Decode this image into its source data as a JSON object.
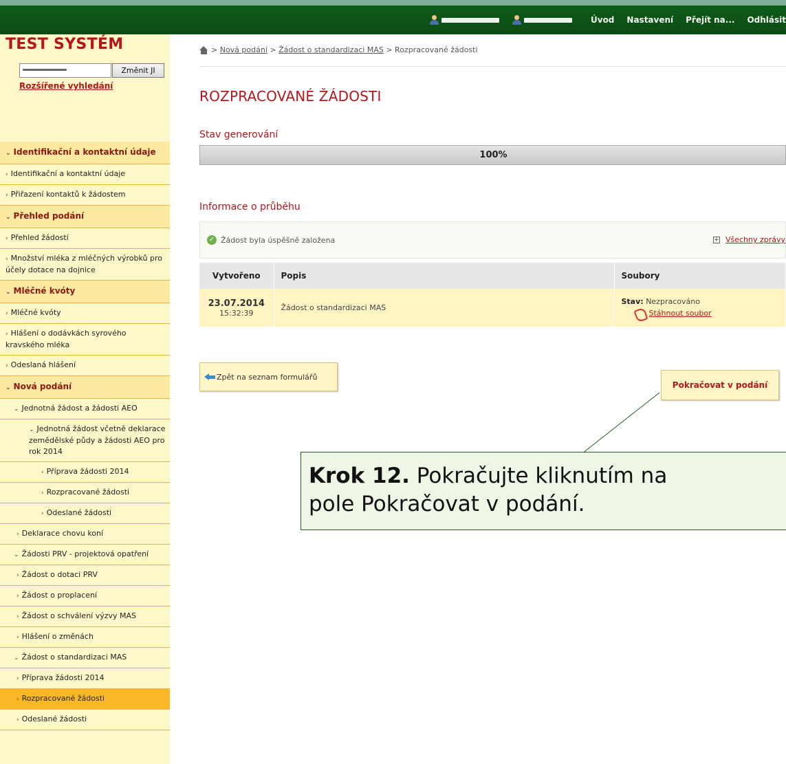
{
  "topbar": {
    "nav": [
      "Úvod",
      "Nastavení",
      "Přejít na...",
      "Odhlásit"
    ]
  },
  "sidebar": {
    "system_title": "TEST SYSTÉM",
    "jid_button": "Změnit JI",
    "advanced_search": "Rozšířené vyhledání",
    "items": [
      {
        "label": "Identifikační a kontaktní údaje",
        "type": "header"
      },
      {
        "label": "Identifikační a kontaktní údaje",
        "type": "l1"
      },
      {
        "label": "Přiřazení kontaktů k žádostem",
        "type": "l1"
      },
      {
        "label": "Přehled podání",
        "type": "header"
      },
      {
        "label": "Přehled žádostí",
        "type": "l1"
      },
      {
        "label": "Množství mléka z mléčných výrobků pro účely dotace na dojnice",
        "type": "l1"
      },
      {
        "label": "Mléčné kvóty",
        "type": "header"
      },
      {
        "label": "Mléčné kvóty",
        "type": "l1"
      },
      {
        "label": "Hlášení o dodávkách syrového kravského mléka",
        "type": "l1"
      },
      {
        "label": "Odeslaná hlášení",
        "type": "l1"
      },
      {
        "label": "Nová podání",
        "type": "header"
      },
      {
        "label": "Jednotná žádost a žádosti AEO",
        "type": "l1-open"
      },
      {
        "label": "Jednotná žádost včetně deklarace zemědělské půdy a žádosti AEO pro rok 2014",
        "type": "l2-open"
      },
      {
        "label": "Příprava žádosti 2014",
        "type": "l3"
      },
      {
        "label": "Rozpracované žádosti",
        "type": "l3"
      },
      {
        "label": "Odeslané žádosti",
        "type": "l3"
      },
      {
        "label": "Deklarace chovu koní",
        "type": "l2"
      },
      {
        "label": "Žádosti PRV - projektová opatření",
        "type": "l1-open"
      },
      {
        "label": "Žádost o dotaci PRV",
        "type": "l2"
      },
      {
        "label": "Žádost o proplacení",
        "type": "l2"
      },
      {
        "label": "Žádost o schválení výzvy MAS",
        "type": "l2"
      },
      {
        "label": "Hlášení o změnách",
        "type": "l2"
      },
      {
        "label": "Žádost o standardizaci MAS",
        "type": "l1-open"
      },
      {
        "label": "Příprava žádosti 2014",
        "type": "l2"
      },
      {
        "label": "Rozpracované žádosti",
        "type": "l2-active"
      },
      {
        "label": "Odeslané žádosti",
        "type": "l2"
      }
    ]
  },
  "breadcrumb": {
    "sep": ">",
    "items": [
      "Nová podání",
      "Žádost o standardizaci MAS"
    ],
    "current": "Rozpracované žádosti"
  },
  "page_title": "ROZPRACOVANÉ ŽÁDOSTI",
  "progress": {
    "heading": "Stav generování",
    "label": "100%",
    "percent": 100
  },
  "info": {
    "heading": "Informace o průběhu",
    "message": "Žádost byla úspěšně založena",
    "all_messages": "Všechny zprávy"
  },
  "table": {
    "headers": [
      "Vytvořeno",
      "Popis",
      "Soubory"
    ],
    "rows": [
      {
        "date": "23.07.2014",
        "time": "15:32:39",
        "desc": "Žádost o standardizaci MAS",
        "status_label": "Stav:",
        "status_value": "Nezpracováno",
        "file_link": "Stáhnout soubor"
      }
    ]
  },
  "buttons": {
    "back": "Zpět na seznam formulářů",
    "continue": "Pokračovat v podání"
  },
  "callout": {
    "step": "Krok 12.",
    "line1": "Pokračujte kliknutím na",
    "line2": "pole Pokračovat v podání."
  },
  "colors": {
    "accent_red": "#b5151b",
    "topbar_green": "#0b4a12",
    "sidebar_bg": "#fef7c9",
    "menu_active": "#fbb826"
  }
}
